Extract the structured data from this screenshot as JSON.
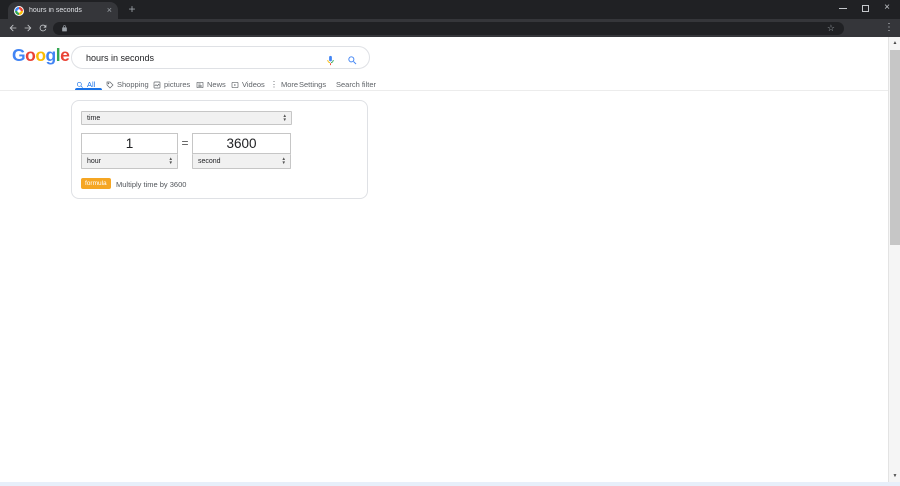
{
  "window": {
    "tab_title": "hours in seconds",
    "close_glyph": "×",
    "newtab_glyph": "+"
  },
  "toolbar": {
    "url_value": "",
    "star_glyph": "☆",
    "menu_glyph": "⋮"
  },
  "logo": {
    "letters": [
      {
        "char": "G"
      },
      {
        "char": "o"
      },
      {
        "char": "o"
      },
      {
        "char": "g"
      },
      {
        "char": "l"
      },
      {
        "char": "e"
      }
    ]
  },
  "search": {
    "query": "hours in seconds"
  },
  "search_tabs": {
    "items": [
      {
        "label": "All",
        "active": true
      },
      {
        "label": "Shopping"
      },
      {
        "label": "pictures"
      },
      {
        "label": "News"
      },
      {
        "label": "Videos"
      },
      {
        "label": "More"
      },
      {
        "label": "Settings"
      },
      {
        "label": "Search filter"
      }
    ],
    "more_glyph": "⋮"
  },
  "converter": {
    "category": "time",
    "from": {
      "value": "1",
      "unit": "hour"
    },
    "equals": "=",
    "to": {
      "value": "3600",
      "unit": "second"
    },
    "formula_badge": "formula",
    "formula_text": "Multiply time by 3600"
  },
  "select_glyphs": {
    "up": "▲",
    "down": "▼"
  },
  "scrollbar": {
    "up_glyph": "▲",
    "down_glyph": "▼"
  },
  "colors": {
    "accent_blue": "#1a73e8",
    "google_blue": "#4285f4",
    "google_red": "#ea4335",
    "google_yellow": "#fbbc05",
    "google_green": "#34a853",
    "formula_badge_orange": "#f5a623",
    "frame_dark": "#202124",
    "toolbar_dark": "#35363a"
  }
}
